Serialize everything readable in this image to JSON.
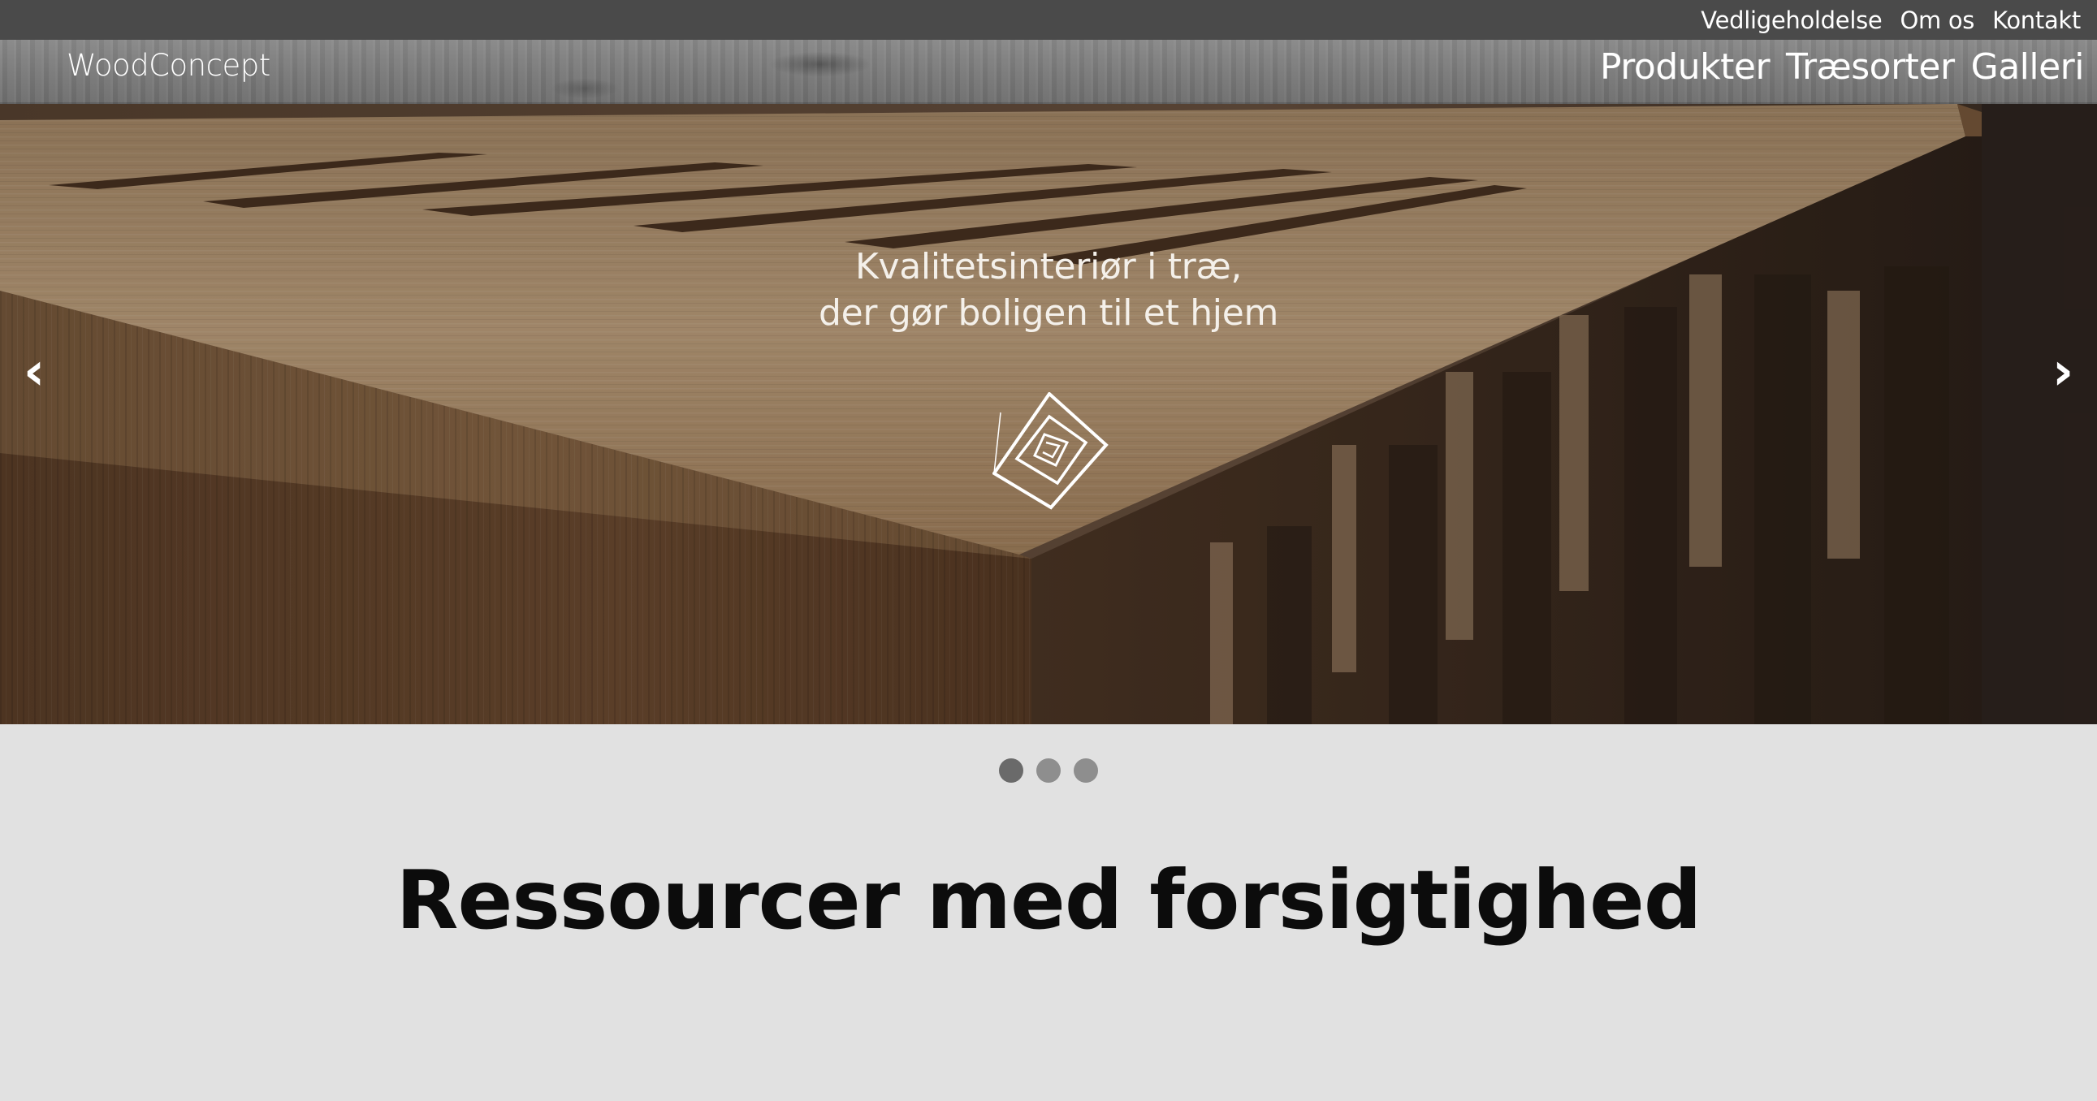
{
  "utility_nav": {
    "items": [
      "Vedligeholdelse",
      "Om os",
      "Kontakt"
    ]
  },
  "header": {
    "brand": "WoodConcept",
    "nav": [
      "Produkter",
      "Træsorter",
      "Galleri"
    ]
  },
  "hero": {
    "caption_line1": "Kvalitetsinteriør i træ,",
    "caption_line2": "der gør boligen til et hjem",
    "prev_glyph": "‹",
    "next_glyph": "›",
    "emblem_icon": "spiral-square-emblem-icon",
    "slide_count": 3,
    "active_slide": 1
  },
  "section": {
    "heading": "Ressourcer med forsigtighed"
  },
  "colors": {
    "utility_bar": "#4a4a4a",
    "page_background": "#e1e1e1",
    "dot_active": "#6a6a6a",
    "dot_inactive": "#8e8e8e",
    "heading_text": "#0c0c0c"
  }
}
